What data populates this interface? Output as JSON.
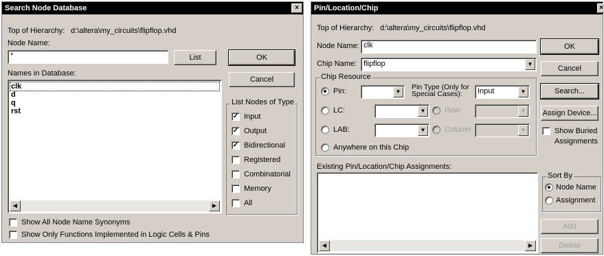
{
  "left_dialog": {
    "title": "Search Node Database",
    "close": "×",
    "top_hierarchy_label": "Top of Hierarchy:",
    "top_hierarchy_value": "d:\\altera\\my_circuits\\flipflop.vhd",
    "node_name_label": "Node Name:",
    "node_name_value": "*",
    "list_button": "List",
    "ok_button": "OK",
    "cancel_button": "Cancel",
    "names_label": "Names in Database:",
    "names": [
      "clk",
      "d",
      "q",
      "rst"
    ],
    "list_nodes_title": "List Nodes of Type",
    "node_types": [
      {
        "label": "Input",
        "checked": true
      },
      {
        "label": "Output",
        "checked": true
      },
      {
        "label": "Bidirectional",
        "checked": true
      },
      {
        "label": "Registered",
        "checked": false
      },
      {
        "label": "Combinatorial",
        "checked": false
      },
      {
        "label": "Memory",
        "checked": false
      },
      {
        "label": "All",
        "checked": false
      }
    ],
    "show_synonyms": "Show All Node Name Synonyms",
    "show_only_functions": "Show Only Functions Implemented in Logic Cells & Pins"
  },
  "right_dialog": {
    "title": "Pin/Location/Chip",
    "close": "×",
    "top_hierarchy_label": "Top of Hierarchy:",
    "top_hierarchy_value": "d:\\altera\\my_circuits\\flipflop.vhd",
    "node_name_label": "Node Name:",
    "node_name_value": "clk",
    "chip_name_label": "Chip Name:",
    "chip_name_value": "flipflop",
    "chip_resource_title": "Chip Resource",
    "pin_label": "Pin:",
    "pin_type_label_1": "Pin Type (Only for",
    "pin_type_label_2": "Special Cases):",
    "pin_type_value": "Input",
    "lc_label": "LC:",
    "row_label": "Row:",
    "lab_label": "LAB:",
    "column_label": "Column:",
    "anywhere_label": "Anywhere on this Chip",
    "existing_label": "Existing Pin/Location/Chip Assignments:",
    "ok_button": "OK",
    "cancel_button": "Cancel",
    "search_button": "Search...",
    "assign_device_button": "Assign Device...",
    "show_buried_1": "Show Buried",
    "show_buried_2": "Assignments",
    "sort_by_title": "Sort By",
    "sort_node_name": "Node Name",
    "sort_assignment": "Assignment",
    "add_button": "Add",
    "delete_button": "Delete"
  }
}
